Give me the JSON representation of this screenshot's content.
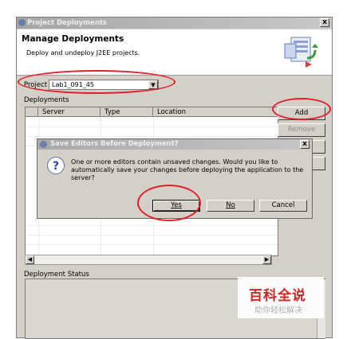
{
  "window": {
    "title": "Project Deployments",
    "close": "x"
  },
  "header": {
    "title": "Manage Deployments",
    "description": "Deploy and undeploy J2EE projects.",
    "banner_icon": "deploy-wizard-icon"
  },
  "project": {
    "label": "Project",
    "value": "Lab1_091_45"
  },
  "deployments": {
    "label": "Deployments",
    "columns": [
      "Server",
      "Type",
      "Location"
    ],
    "buttons": {
      "add": "Add",
      "remove": "Remove"
    }
  },
  "deployment_status": {
    "label": "Deployment Status"
  },
  "dialog": {
    "title": "Save Editors Before Deployment?",
    "close": "x",
    "icon": "question-icon",
    "message": "One or more editors contain unsaved changes.  Would you like to automatically save your changes before deploying the application to the server?",
    "buttons": {
      "yes": "Yes",
      "no": "No",
      "cancel": "Cancel"
    }
  },
  "watermark": {
    "brand": "百科全说",
    "tagline": "助你轻松解决"
  },
  "colors": {
    "annotation_ring": "#e0202a",
    "watermark_red": "#cc2727"
  }
}
